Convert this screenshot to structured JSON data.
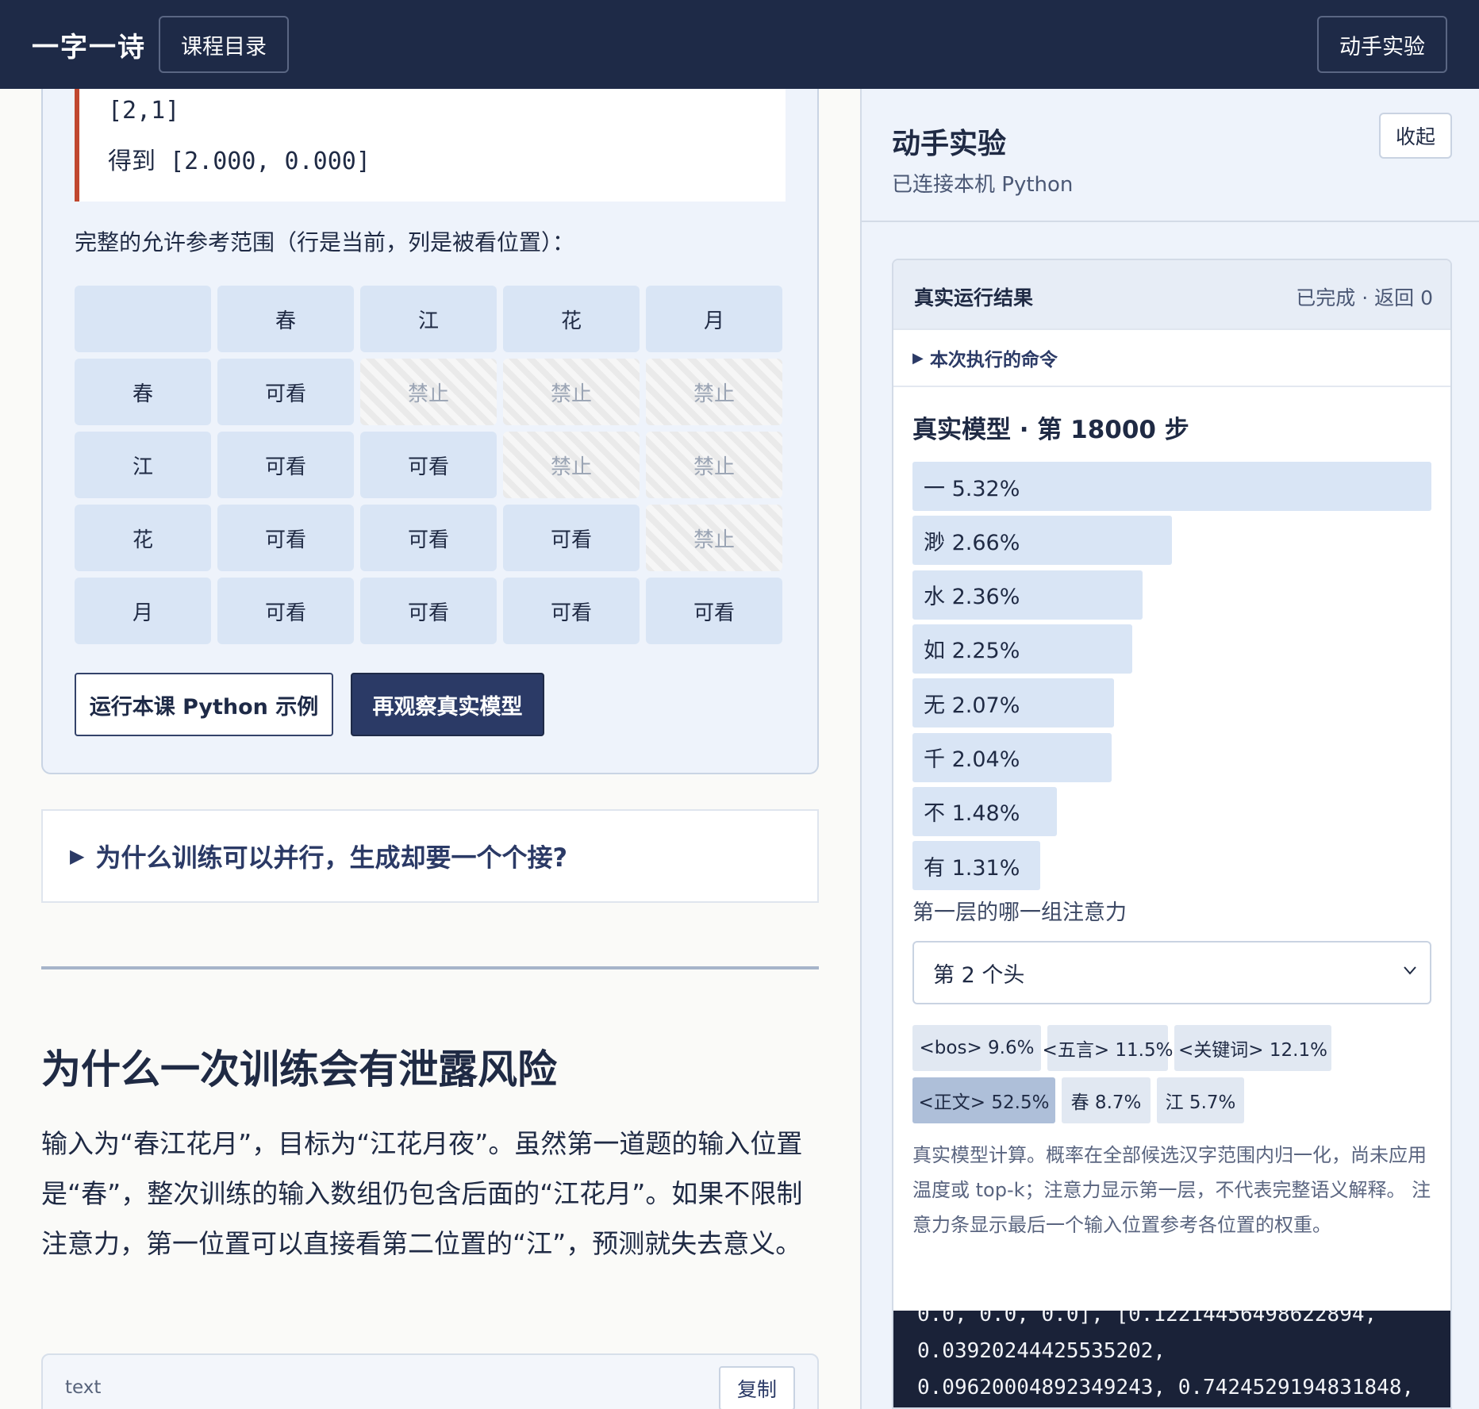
{
  "header": {
    "brand": "一字一诗",
    "catalog_label": "课程目录",
    "lab_label": "动手实验"
  },
  "lesson": {
    "code_lines": [
      "[2,1]",
      "得到 [2.000, 0.000]"
    ],
    "range_caption": "完整的允许参考范围（行是当前，列是被看位置）：",
    "grid": {
      "columns": [
        "",
        "春",
        "江",
        "花",
        "月"
      ],
      "rows": [
        {
          "label": "春",
          "cells": [
            "可看",
            "禁止",
            "禁止",
            "禁止"
          ]
        },
        {
          "label": "江",
          "cells": [
            "可看",
            "可看",
            "禁止",
            "禁止"
          ]
        },
        {
          "label": "花",
          "cells": [
            "可看",
            "可看",
            "可看",
            "禁止"
          ]
        },
        {
          "label": "月",
          "cells": [
            "可看",
            "可看",
            "可看",
            "可看"
          ]
        }
      ]
    },
    "run_button": "运行本课 Python 示例",
    "observe_button": "再观察真实模型",
    "details_summary": "为什么训练可以并行，生成却要一个个接?",
    "section_title": "为什么一次训练会有泄露风险",
    "paragraph": "输入为“春江花月”，目标为“江花月夜”。虽然第一道题的输入位置是“春”，整次训练的输入数组仍包含后面的“江花月”。如果不限制注意力，第一位置可以直接看第二位置的“江”，预测就失去意义。",
    "text_block_label": "text",
    "copy_button": "复制"
  },
  "panel": {
    "title": "动手实验",
    "subtitle": "已连接本机 Python",
    "collapse_button": "收起",
    "result": {
      "title": "真实运行结果",
      "status": "已完成 · 返回 0",
      "command_summary": "本次执行的命令",
      "model_title": "真实模型 · 第 18000 步",
      "predictions": [
        {
          "char": "一",
          "label": "一 5.32%",
          "prob": 5.32
        },
        {
          "char": "渺",
          "label": "渺 2.66%",
          "prob": 2.66
        },
        {
          "char": "水",
          "label": "水 2.36%",
          "prob": 2.36
        },
        {
          "char": "如",
          "label": "如 2.25%",
          "prob": 2.25
        },
        {
          "char": "无",
          "label": "无 2.07%",
          "prob": 2.07
        },
        {
          "char": "千",
          "label": "千 2.04%",
          "prob": 2.04
        },
        {
          "char": "不",
          "label": "不 1.48%",
          "prob": 1.48
        },
        {
          "char": "有",
          "label": "有 1.31%",
          "prob": 1.31
        }
      ],
      "attention_label": "第一层的哪一组注意力",
      "head_select_value": "第 2 个头",
      "attention_chips": [
        {
          "label": "<bos> 9.6%",
          "weight": 9.6
        },
        {
          "label": "<五言> 11.5%",
          "weight": 11.5
        },
        {
          "label": "<关键词> 12.1%",
          "weight": 12.1
        },
        {
          "label": "<正文> 52.5%",
          "weight": 52.5,
          "highlight": true
        },
        {
          "label": "春 8.7%",
          "weight": 8.7
        },
        {
          "label": "江 5.7%",
          "weight": 5.7
        }
      ],
      "note": "真实模型计算。概率在全部候选汉字范围内归一化，尚未应用温度或 top-k；注意力显示第一层，不代表完整语义解释。 注意力条显示最后一个输入位置参考各位置的权重。",
      "console_lines": [
        "0.0, 0.0, 0.0], [0.12214456498622894,",
        "0.03920244425535202,",
        "0.09620004892349243, 0.7424529194831848,"
      ]
    }
  }
}
